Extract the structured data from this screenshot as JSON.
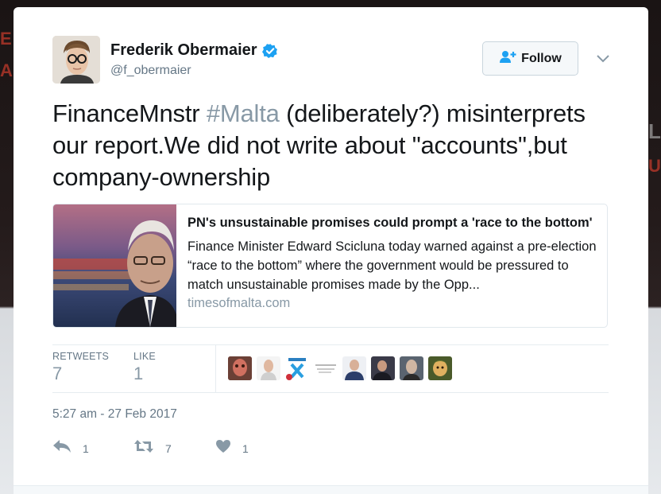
{
  "tweet": {
    "author": {
      "display_name": "Frederik Obermaier",
      "handle": "@f_obermaier",
      "verified": true
    },
    "follow_label": "Follow",
    "text_parts": {
      "before": "FinanceMnstr ",
      "hashtag": "#Malta",
      "after": " (deliberately?) misinterprets our report.We did not write about \"accounts\",but company-ownership"
    },
    "link_card": {
      "title": "PN's unsustainable promises could prompt a 'race to the bottom'",
      "description": "Finance Minister Edward Scicluna today warned against a pre-election “race to the bottom” where the government would be pressured to match unsustainable promises made by the Opp...",
      "domain": "timesofmalta.com"
    },
    "stats": {
      "retweets_label": "RETWEETS",
      "retweets_value": "7",
      "likes_label": "LIKE",
      "likes_value": "1"
    },
    "timestamp": "5:27 am - 27 Feb 2017",
    "actions": {
      "reply_count": "1",
      "retweet_count": "7",
      "like_count": "1"
    }
  },
  "colors": {
    "hashtag": "#8899a6",
    "verified": "#1da1f2",
    "text": "#14171a",
    "muted": "#657786"
  },
  "icons": [
    "verified-badge-icon",
    "add-user-icon",
    "chevron-down-icon",
    "reply-icon",
    "retweet-icon",
    "heart-icon"
  ]
}
